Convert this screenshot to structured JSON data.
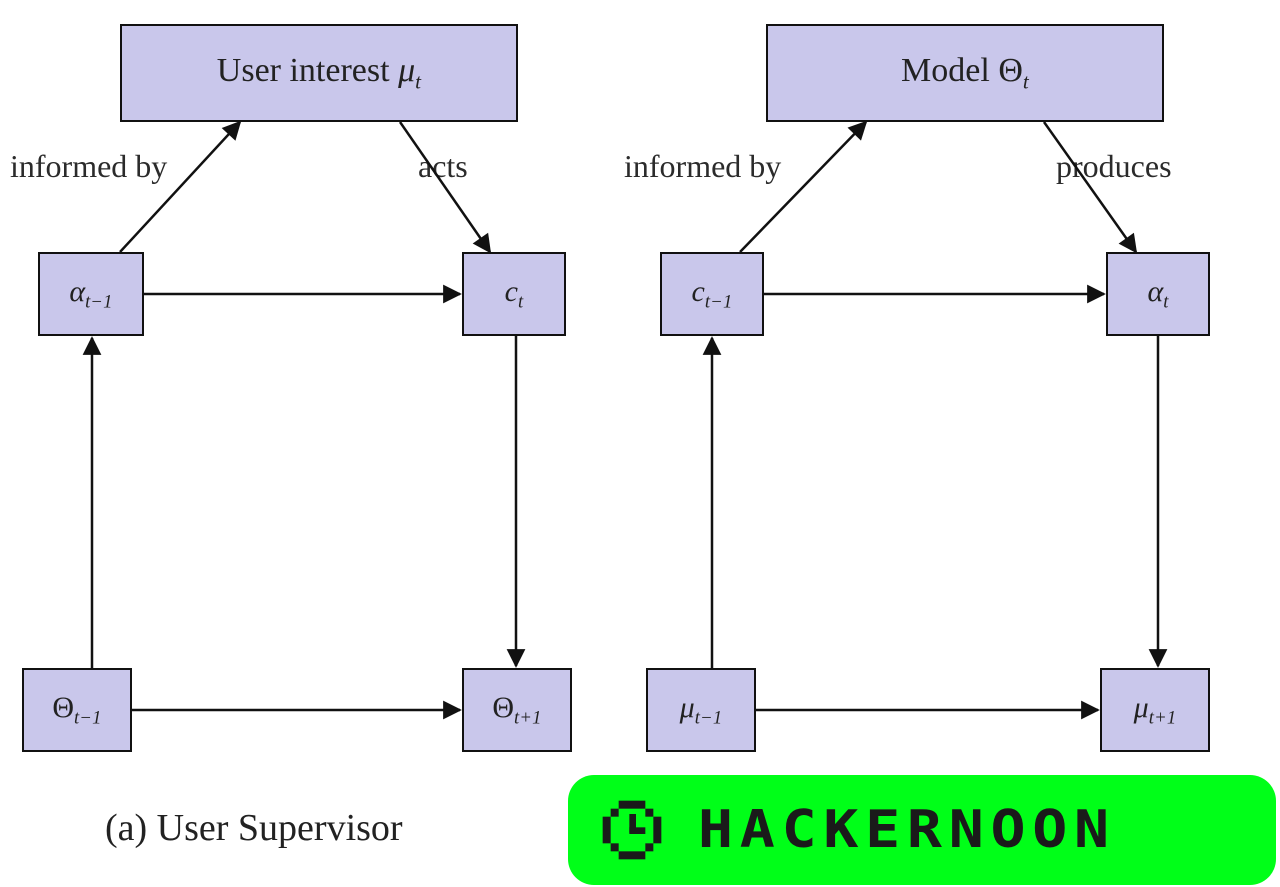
{
  "colors": {
    "node_fill": "#c9c7eb",
    "node_stroke": "#111111",
    "badge_bg": "#00ff18"
  },
  "left": {
    "top_box": {
      "prefix": "User interest ",
      "symbol": "μ",
      "sub": "t"
    },
    "edge_left_label": "informed by",
    "edge_right_label": "acts",
    "node_a": {
      "symbol": "α",
      "sub": "t−1"
    },
    "node_b": {
      "symbol": "c",
      "sub": "t"
    },
    "node_c": {
      "symbol": "Θ",
      "sub": "t−1"
    },
    "node_d": {
      "symbol": "Θ",
      "sub": "t+1"
    },
    "caption": "(a) User Supervisor"
  },
  "right": {
    "top_box": {
      "prefix": "Model ",
      "symbol": "Θ",
      "sub": "t"
    },
    "edge_left_label": "informed by",
    "edge_right_label": "produces",
    "node_a": {
      "symbol": "c",
      "sub": "t−1"
    },
    "node_b": {
      "symbol": "α",
      "sub": "t"
    },
    "node_c": {
      "symbol": "μ",
      "sub": "t−1"
    },
    "node_d": {
      "symbol": "μ",
      "sub": "t+1"
    }
  },
  "badge": {
    "text": "HACKERNOON"
  }
}
